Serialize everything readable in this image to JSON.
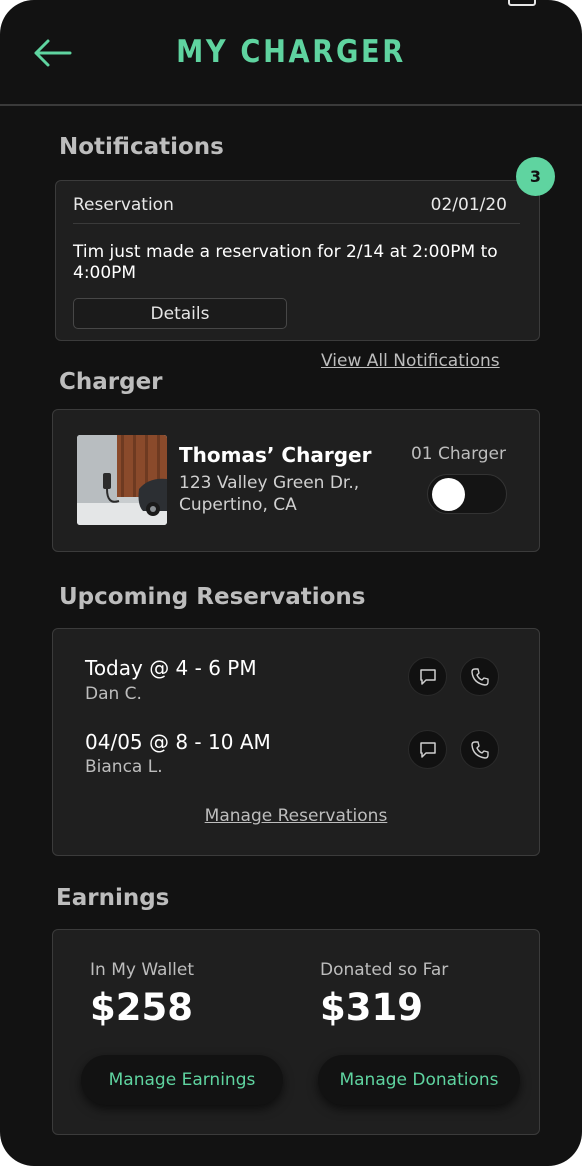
{
  "header": {
    "title": "MY CHARGER",
    "back_icon": "arrow-left-icon"
  },
  "colors": {
    "accent": "#5fd4a0",
    "background": "#121212",
    "card": "#1f1f1f"
  },
  "notifications": {
    "section_title": "Notifications",
    "badge_count": "3",
    "item": {
      "type": "Reservation",
      "date": "02/01/20",
      "message": "Tim just made a reservation for 2/14 at 2:00PM to 4:00PM",
      "details_label": "Details"
    },
    "view_all_label": "View All Notifications"
  },
  "charger": {
    "section_title": "Charger",
    "name": "Thomas’ Charger",
    "address_line1": "123 Valley Green Dr.,",
    "address_line2": "Cupertino, CA",
    "count_label": "01 Charger",
    "toggle_on": false
  },
  "reservations": {
    "section_title": "Upcoming Reservations",
    "items": [
      {
        "when": "Today @ 4 - 6 PM",
        "who": "Dan C."
      },
      {
        "when": "04/05 @ 8 - 10 AM",
        "who": "Bianca L."
      }
    ],
    "manage_label": "Manage Reservations"
  },
  "earnings": {
    "section_title": "Earnings",
    "wallet_label": "In My Wallet",
    "wallet_value": "$258",
    "donated_label": "Donated so Far",
    "donated_value": "$319",
    "manage_earnings_label": "Manage Earnings",
    "manage_donations_label": "Manage Donations"
  }
}
